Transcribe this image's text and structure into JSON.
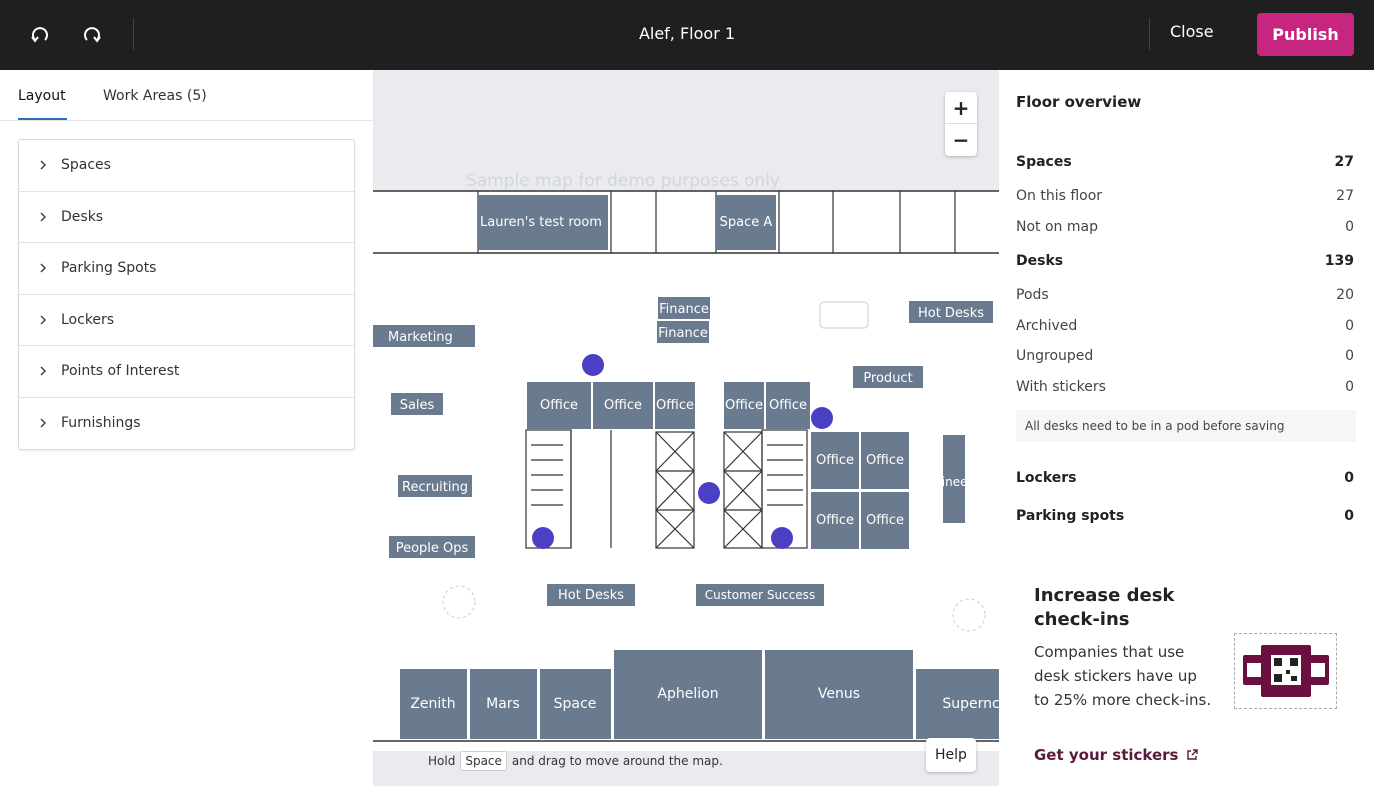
{
  "topbar": {
    "title": "Alef, Floor 1",
    "close_label": "Close",
    "publish_label": "Publish",
    "undo_icon": "undo-icon",
    "redo_icon": "redo-icon",
    "publish_color": "#c6267f"
  },
  "left": {
    "tabs": [
      {
        "label": "Layout",
        "active": true
      },
      {
        "label": "Work Areas (5)",
        "active": false
      }
    ],
    "items": [
      {
        "label": "Spaces"
      },
      {
        "label": "Desks"
      },
      {
        "label": "Parking Spots"
      },
      {
        "label": "Lockers"
      },
      {
        "label": "Points of Interest"
      },
      {
        "label": "Furnishings"
      }
    ]
  },
  "map": {
    "watermark": "Sample map for demo purposes only",
    "hint_before": "Hold",
    "hint_key": "Space",
    "hint_after": "and drag to move around the map.",
    "help_label": "Help",
    "zoom_in": "+",
    "zoom_out": "−",
    "rooms_top": [
      "Lauren's test room",
      "Space A"
    ],
    "rooms_bottom": [
      "Zenith",
      "Mars",
      "Space",
      "Aphelion",
      "Venus",
      "Supernc"
    ],
    "offices": [
      "Office",
      "Office",
      "Office",
      "Office",
      "Office",
      "Office",
      "Office",
      "Office",
      "Office"
    ],
    "desk_labels": [
      "Marketing",
      "Finance",
      "Finance",
      "Hot Desks",
      "Product",
      "Sales",
      "Recruiting",
      "People Ops",
      "Engineering",
      "Hot Desks",
      "Customer Success"
    ]
  },
  "overview": {
    "title": "Floor overview",
    "rows": [
      {
        "label": "Spaces",
        "value": "27",
        "bold": true
      },
      {
        "label": "On this floor",
        "value": "27"
      },
      {
        "label": "Not on map",
        "value": "0"
      },
      {
        "label": "Desks",
        "value": "139",
        "bold": true
      },
      {
        "label": "Pods",
        "value": "20"
      },
      {
        "label": "Archived",
        "value": "0"
      },
      {
        "label": "Ungrouped",
        "value": "0"
      },
      {
        "label": "With stickers",
        "value": "0"
      }
    ],
    "note": "All desks need to be in a pod before saving",
    "rows2": [
      {
        "label": "Lockers",
        "value": "0",
        "bold": true
      },
      {
        "label": "Parking spots",
        "value": "0",
        "bold": true
      }
    ]
  },
  "promo": {
    "title": "Increase desk check-ins",
    "text": "Companies that use desk stickers have up to 25% more check-ins.",
    "link": "Get your stickers"
  }
}
